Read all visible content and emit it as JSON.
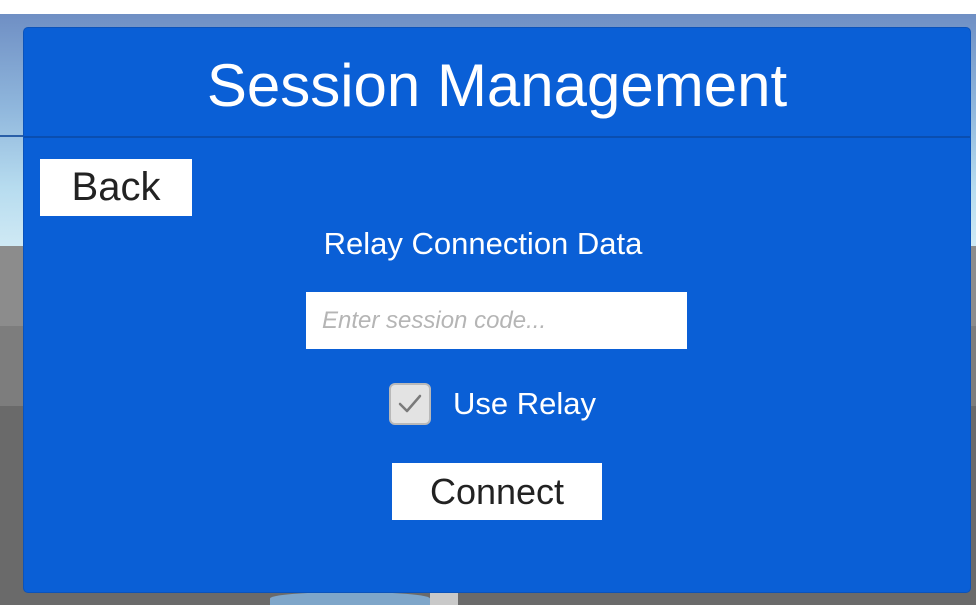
{
  "panel": {
    "title": "Session Management",
    "back_label": "Back",
    "section_label": "Relay Connection Data",
    "session_code": {
      "value": "",
      "placeholder": "Enter session code..."
    },
    "use_relay": {
      "label": "Use Relay",
      "checked": true,
      "icon": "check-icon"
    },
    "connect_label": "Connect"
  },
  "colors": {
    "panel_bg": "#0a5fd6",
    "button_bg": "#ffffff",
    "text_light": "#ffffff",
    "text_dark": "#222222"
  }
}
